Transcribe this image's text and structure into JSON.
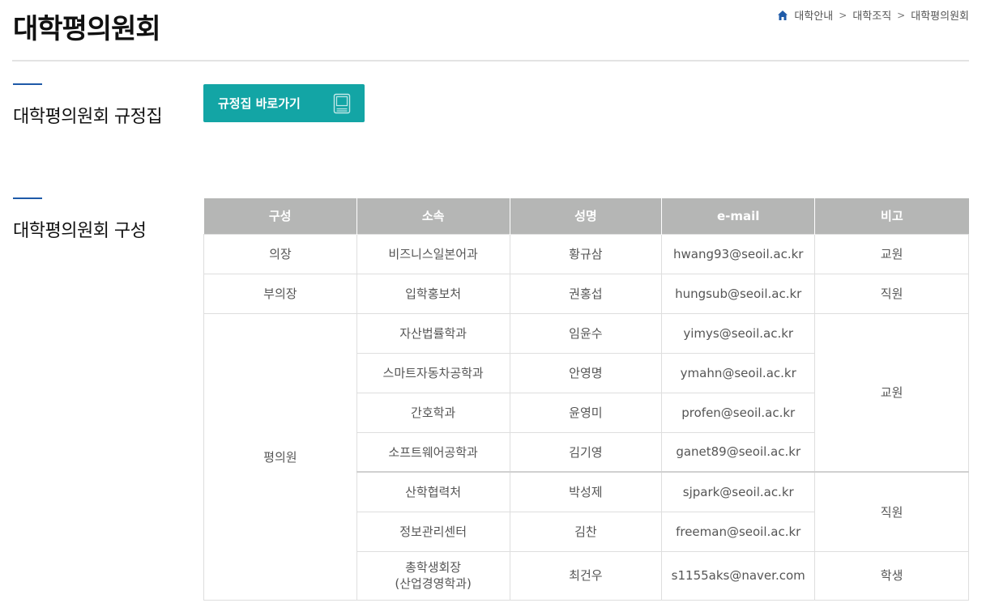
{
  "header": {
    "title": "대학평의원회",
    "breadcrumb": [
      "대학안내",
      "대학조직",
      "대학평의원회"
    ],
    "breadcrumb_separator": ">",
    "home_icon": "home-icon"
  },
  "sections": {
    "regulations": {
      "title": "대학평의원회 규정집",
      "button_label": "규정집 바로가기",
      "button_icon": "book-icon",
      "button_color": "#13a5a5"
    },
    "composition": {
      "title": "대학평의원회 구성"
    }
  },
  "table": {
    "headers": [
      "구성",
      "소속",
      "성명",
      "e-mail",
      "비고"
    ],
    "header_color": "#b5b6b5",
    "rows": [
      {
        "role": "의장",
        "dept": "비즈니스일본어과",
        "name": "황규삼",
        "email": "hwang93@seoil.ac.kr",
        "note": "교원"
      },
      {
        "role": "부의장",
        "dept": "입학홍보처",
        "name": "권홍섭",
        "email": "hungsub@seoil.ac.kr",
        "note": "직원"
      },
      {
        "role": "평의원",
        "dept": "자산법률학과",
        "name": "임윤수",
        "email": "yimys@seoil.ac.kr",
        "note": "교원"
      },
      {
        "dept": "스마트자동차공학과",
        "name": "안영명",
        "email": "ymahn@seoil.ac.kr"
      },
      {
        "dept": "간호학과",
        "name": "윤영미",
        "email": "profen@seoil.ac.kr"
      },
      {
        "dept": "소프트웨어공학과",
        "name": "김기영",
        "email": "ganet89@seoil.ac.kr"
      },
      {
        "dept": "산학협력처",
        "name": "박성제",
        "email": "sjpark@seoil.ac.kr",
        "note": "직원"
      },
      {
        "dept": "정보관리센터",
        "name": "김찬",
        "email": "freeman@seoil.ac.kr"
      },
      {
        "dept_line1": "총학생회장",
        "dept_line2": "(산업경영학과)",
        "name": "최건우",
        "email": "s1155aks@naver.com",
        "note": "학생"
      }
    ]
  },
  "colors": {
    "accent_bar": "#1e5aa8"
  }
}
